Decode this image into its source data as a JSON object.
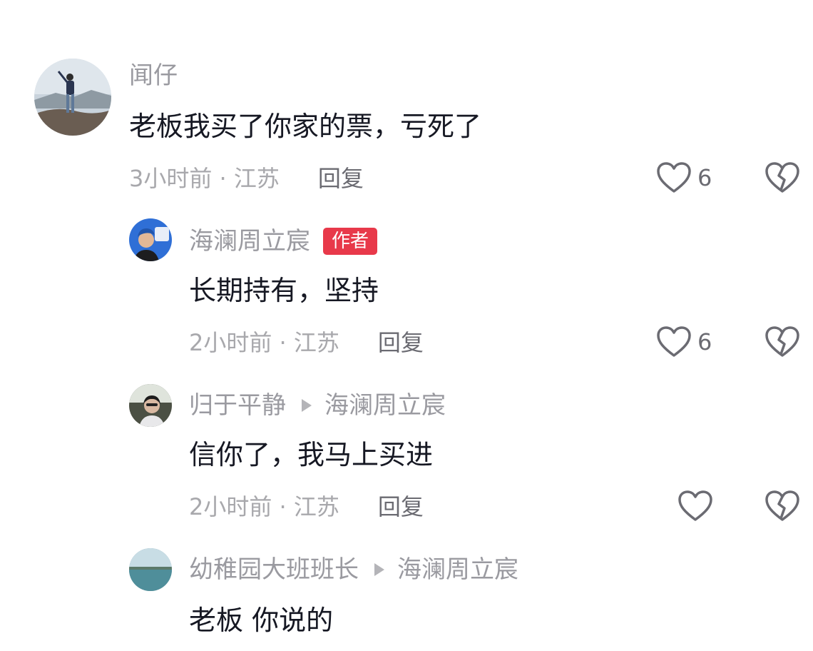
{
  "comments": [
    {
      "username": "闻仔",
      "text": "老板我买了你家的票，亏死了",
      "time_location": "3小时前 · 江苏",
      "reply_label": "回复",
      "likes": "6"
    },
    {
      "username": "海澜周立宸",
      "badge": "作者",
      "text": "长期持有，坚持",
      "time_location": "2小时前 · 江苏",
      "reply_label": "回复",
      "likes": "6"
    },
    {
      "username": "归于平静",
      "reply_to": "海澜周立宸",
      "text": "信你了，我马上买进",
      "time_location": "2小时前 · 江苏",
      "reply_label": "回复"
    },
    {
      "username": "幼稚园大班班长",
      "reply_to": "海澜周立宸",
      "text": "老板  你说的"
    }
  ],
  "colors": {
    "author_badge": "#e8394a",
    "muted_text": "#9a9aa0",
    "body_text": "#161823"
  },
  "icons": [
    "heart-outline-icon",
    "broken-heart-icon",
    "reply-arrow-icon"
  ]
}
